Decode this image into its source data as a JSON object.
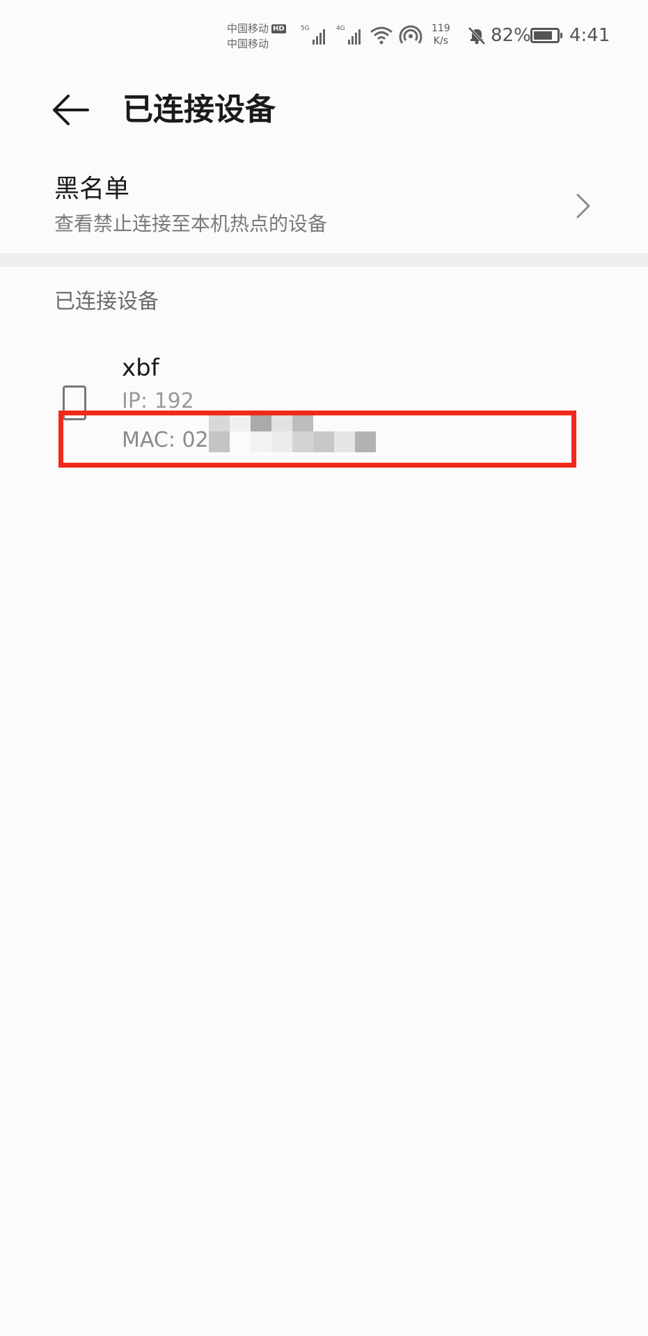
{
  "status_bar": {
    "carrier_1": "中国移动",
    "carrier_1_badge": "HD",
    "carrier_2": "中国移动",
    "signal_1_generation": "5G",
    "signal_2_generation": "4G",
    "speed_value": "119",
    "speed_unit": "K/s",
    "battery_percent": "82%",
    "battery_level": 0.82,
    "time": "4:41",
    "icons": [
      "signal-icon",
      "signal-icon",
      "wifi-icon",
      "hotspot-icon",
      "mute-bell-icon",
      "battery-icon"
    ]
  },
  "header": {
    "back_icon": "back-arrow-icon",
    "title": "已连接设备"
  },
  "blacklist": {
    "title": "黑名单",
    "subtitle": "查看禁止连接至本机热点的设备",
    "icon": "chevron-right-icon"
  },
  "connected_section": {
    "header": "已连接设备",
    "devices": [
      {
        "icon": "phone-icon",
        "name": "xbf",
        "ip_label": "IP: 192",
        "mac_label": "MAC: 02"
      }
    ]
  },
  "colors": {
    "highlight": "#f02a1a",
    "background": "#fbfbfb",
    "secondary_text": "#7a7a7a"
  }
}
